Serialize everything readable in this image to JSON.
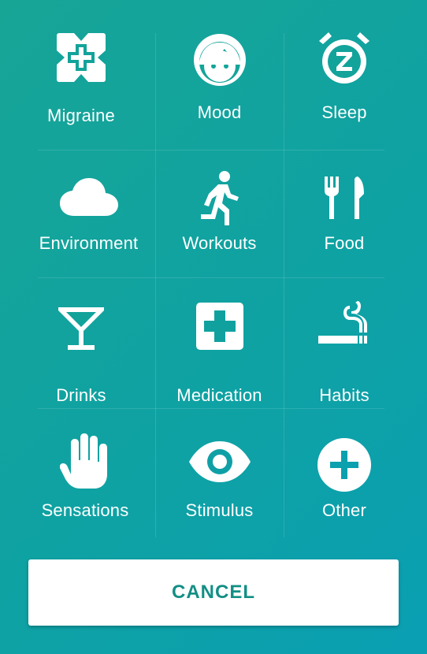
{
  "categories": [
    {
      "label": "Migraine",
      "icon": "migraine-icon"
    },
    {
      "label": "Mood",
      "icon": "face-icon"
    },
    {
      "label": "Sleep",
      "icon": "alarm-clock-icon"
    },
    {
      "label": "Environment",
      "icon": "cloud-icon"
    },
    {
      "label": "Workouts",
      "icon": "running-person-icon"
    },
    {
      "label": "Food",
      "icon": "fork-knife-icon"
    },
    {
      "label": "Drinks",
      "icon": "cocktail-glass-icon"
    },
    {
      "label": "Medication",
      "icon": "medical-cross-icon"
    },
    {
      "label": "Habits",
      "icon": "cigarette-icon"
    },
    {
      "label": "Sensations",
      "icon": "hand-icon"
    },
    {
      "label": "Stimulus",
      "icon": "eye-icon"
    },
    {
      "label": "Other",
      "icon": "plus-circle-icon"
    }
  ],
  "cancel_label": "CANCEL",
  "colors": {
    "background_start": "#17a596",
    "background_end": "#0a9fb3",
    "button_text": "#138f85"
  }
}
